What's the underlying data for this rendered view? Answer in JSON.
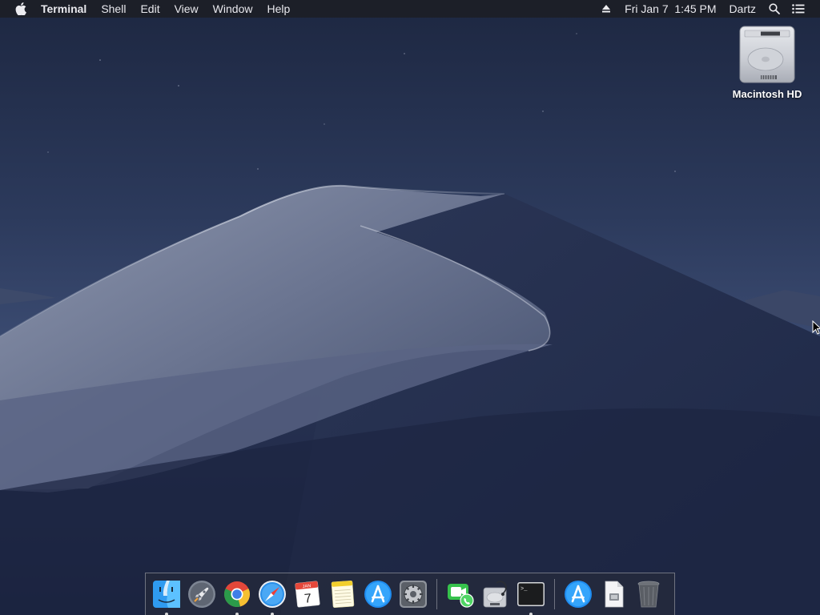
{
  "menubar": {
    "app_name": "Terminal",
    "menus": [
      "Shell",
      "Edit",
      "View",
      "Window",
      "Help"
    ],
    "datetime": "Fri Jan 7  1:45 PM",
    "user": "Dartz",
    "icons": [
      "apple-icon",
      "eject-icon",
      "spotlight-search-icon",
      "notification-center-icon"
    ]
  },
  "desktop": {
    "icons": [
      {
        "label": "Macintosh HD",
        "icon": "hard-drive-icon"
      }
    ]
  },
  "dock": {
    "apps": [
      {
        "name": "Finder",
        "icon": "finder-icon",
        "running": true
      },
      {
        "name": "Launchpad",
        "icon": "launchpad-icon",
        "running": true
      },
      {
        "name": "Google Chrome",
        "icon": "chrome-icon",
        "running": true
      },
      {
        "name": "Safari",
        "icon": "safari-icon",
        "running": true
      },
      {
        "name": "Calendar",
        "icon": "calendar-icon",
        "running": false,
        "calendar_month": "JAN",
        "calendar_day": "7"
      },
      {
        "name": "Notes",
        "icon": "notes-icon",
        "running": false
      },
      {
        "name": "App Store",
        "icon": "app-store-icon",
        "running": false
      },
      {
        "name": "System Preferences",
        "icon": "system-preferences-icon",
        "running": false
      },
      {
        "name": "FaceTime",
        "icon": "facetime-icon",
        "running": false
      },
      {
        "name": "Disk Utility",
        "icon": "disk-utility-icon",
        "running": false
      },
      {
        "name": "Terminal",
        "icon": "terminal-icon",
        "running": true,
        "terminal_prompt": ">_"
      },
      {
        "name": "App Store Downloads",
        "icon": "app-store-downloads-icon",
        "running": false
      },
      {
        "name": "Document",
        "icon": "document-icon",
        "running": false
      },
      {
        "name": "Trash",
        "icon": "trash-icon",
        "running": false
      }
    ]
  },
  "colors": {
    "menubar_bg": "#1c1e26",
    "menubar_text": "#e9e9ee",
    "dune_light": "#b9c0d2",
    "sky_dark": "#1f2a44"
  }
}
